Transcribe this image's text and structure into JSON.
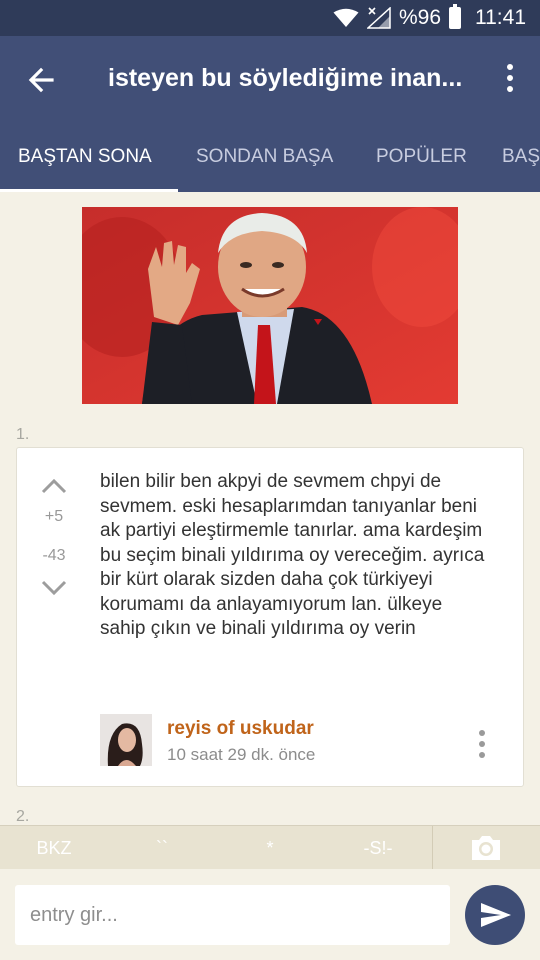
{
  "status_bar": {
    "battery": "%96",
    "time": "11:41"
  },
  "app_bar": {
    "title": "isteyen bu söylediğime inan..."
  },
  "tabs": [
    {
      "label": "BAŞTAN SONA",
      "active": true
    },
    {
      "label": "SONDAN BAŞA",
      "active": false
    },
    {
      "label": "POPÜLER",
      "active": false
    },
    {
      "label": "BAŞ",
      "active": false
    }
  ],
  "entries": [
    {
      "index": "1.",
      "upvotes": "+5",
      "downvotes": "-43",
      "text": "bilen bilir ben akpyi de sevmem chpyi de sevmem. eski hesaplarımdan tanıyanlar beni ak partiyi eleştirmemle tanırlar. ama kardeşim bu seçim binali yıldırıma oy vereceğim. ayrıca bir kürt olarak sizden daha çok türkiyeyi korumamı da anlayamıyorum lan. ülkeye sahip çıkın ve binali yıldırıma oy verin",
      "author": "reyis of uskudar",
      "time": "10 saat 29 dk. önce"
    },
    {
      "index": "2."
    }
  ],
  "toolbar": {
    "bkz": "BKZ",
    "backtick": "``",
    "star": "*",
    "spoiler": "-S!-"
  },
  "input": {
    "placeholder": "entry gir..."
  },
  "colors": {
    "app_bar": "#414f77",
    "status_bar": "#2f3b59",
    "background": "#f4f1e6",
    "author": "#c0641a",
    "send_button": "#3e4d75"
  }
}
